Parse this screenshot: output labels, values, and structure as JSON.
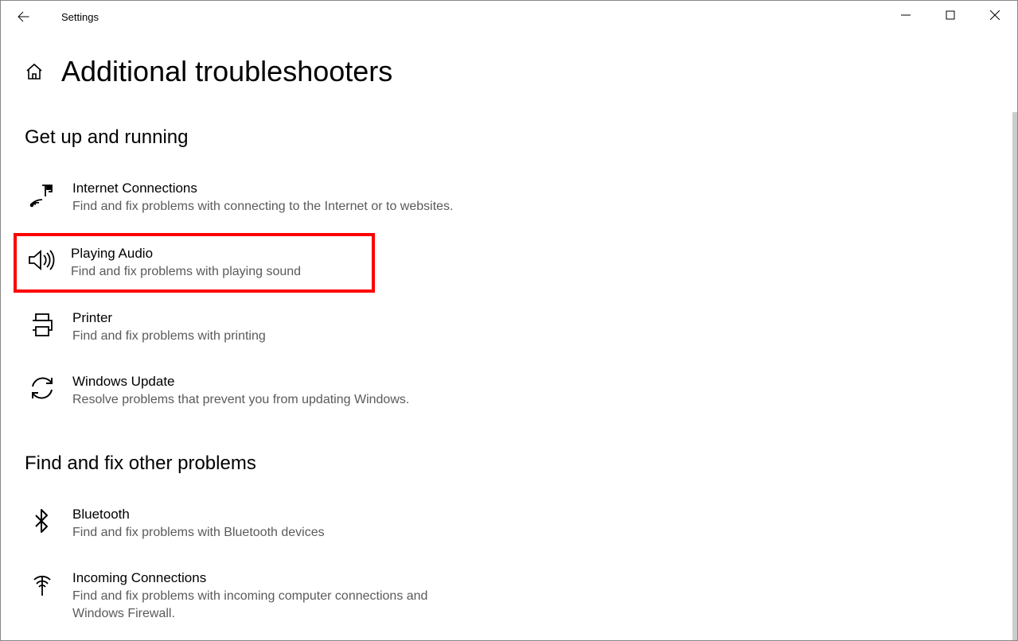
{
  "app_title": "Settings",
  "page_title": "Additional troubleshooters",
  "sections": [
    {
      "title": "Get up and running",
      "items": [
        {
          "title": "Internet Connections",
          "desc": "Find and fix problems with connecting to the Internet or to websites."
        },
        {
          "title": "Playing Audio",
          "desc": "Find and fix problems with playing sound"
        },
        {
          "title": "Printer",
          "desc": "Find and fix problems with printing"
        },
        {
          "title": "Windows Update",
          "desc": "Resolve problems that prevent you from updating Windows."
        }
      ]
    },
    {
      "title": "Find and fix other problems",
      "items": [
        {
          "title": "Bluetooth",
          "desc": "Find and fix problems with Bluetooth devices"
        },
        {
          "title": "Incoming Connections",
          "desc": "Find and fix problems with incoming computer connections and Windows Firewall."
        }
      ]
    }
  ]
}
